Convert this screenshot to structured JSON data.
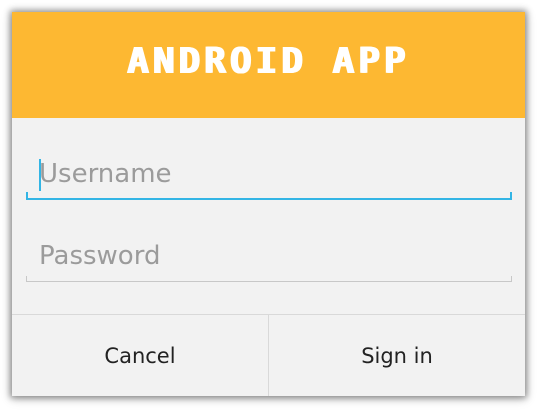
{
  "header": {
    "title": "ANDROID APP"
  },
  "form": {
    "username": {
      "value": "",
      "placeholder": "Username"
    },
    "password": {
      "value": "",
      "placeholder": "Password"
    }
  },
  "buttons": {
    "cancel_label": "Cancel",
    "signin_label": "Sign in"
  },
  "colors": {
    "header_bg": "#fdb832",
    "accent": "#33b5e5",
    "dialog_bg": "#f2f2f2"
  }
}
